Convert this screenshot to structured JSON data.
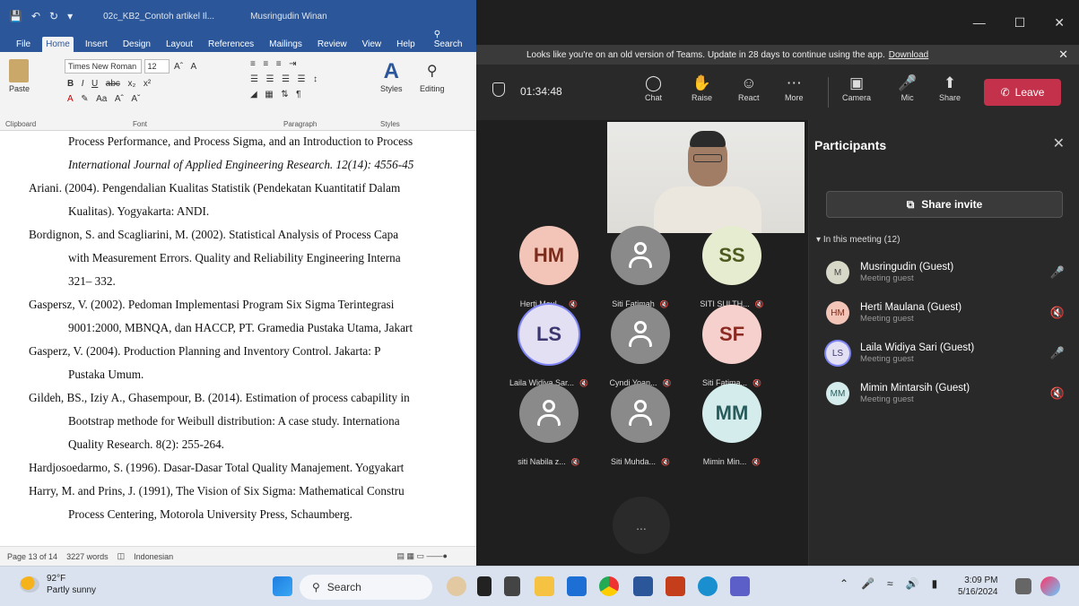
{
  "word": {
    "title_doc": "02c_KB2_Contoh artikel Il...",
    "title_user": "Musringudin Winan",
    "tabs": [
      "File",
      "Home",
      "Insert",
      "Design",
      "Layout",
      "References",
      "Mailings",
      "Review",
      "View",
      "Help"
    ],
    "search_label": "Search",
    "ribbon": {
      "paste": "Paste",
      "font_name": "Times New Roman",
      "font_size": "12",
      "styles": "Styles",
      "editing": "Editing",
      "group_clipboard": "Clipboard",
      "group_font": "Font",
      "group_paragraph": "Paragraph",
      "group_styles": "Styles"
    },
    "lines": [
      {
        "t": "Process Performance, and Process Sigma, and an Introduction to Process",
        "indent": true,
        "italic": false
      },
      {
        "t": "International Journal of Applied Engineering Research.  12(14): 4556-45",
        "indent": true,
        "italic": true
      },
      {
        "t": "Ariani. (2004). Pengendalian Kualitas Statistik (Pendekatan Kuantitatif Dalam",
        "indent": false,
        "italic": false
      },
      {
        "t": "Kualitas).  Yogyakarta: ANDI.",
        "indent": true,
        "italic": false
      },
      {
        "t": "Bordignon, S. and Scagliarini, M. (2002). Statistical Analysis of Process Capa",
        "indent": false,
        "italic": false
      },
      {
        "t": "with Measurement Errors. Quality and Reliability Engineering Interna",
        "indent": true,
        "italic": false
      },
      {
        "t": "321– 332.",
        "indent": true,
        "italic": false
      },
      {
        "t": "Gaspersz, V. (2002). Pedoman Implementasi Program Six Sigma Terintegrasi",
        "indent": false,
        "italic": false
      },
      {
        "t": "9001:2000, MBNQA, dan HACCP, PT. Gramedia Pustaka Utama, Jakart",
        "indent": true,
        "italic": false
      },
      {
        "t": "Gasperz, V. (2004). Production Planning and Inventory Control. Jakarta: P",
        "indent": false,
        "italic": false
      },
      {
        "t": "Pustaka Umum.",
        "indent": true,
        "italic": false
      },
      {
        "t": "Gildeh, BS., Iziy A., Ghasempour, B.  (2014).  Estimation of process cabapility in",
        "indent": false,
        "italic": false
      },
      {
        "t": "Bootstrap methode for Weibull distribution: A case study.  Internationa",
        "indent": true,
        "italic": false
      },
      {
        "t": "Quality Research. 8(2): 255-264.",
        "indent": true,
        "italic": false
      },
      {
        "t": "Hardjosoedarmo, S. (1996). Dasar-Dasar Total Quality Manajement. Yogyakart",
        "indent": false,
        "italic": false
      },
      {
        "t": "Harry, M. and Prins, J. (1991), The Vision of Six Sigma: Mathematical Constru",
        "indent": false,
        "italic": false
      },
      {
        "t": "Process Centering, Motorola University Press, Schaumberg.",
        "indent": true,
        "italic": false
      }
    ],
    "status": {
      "page": "Page 13 of 14",
      "words": "3227 words",
      "lang": "Indonesian"
    }
  },
  "teams": {
    "banner_text": "Looks like you're on an old version of Teams. Update in 28 days to continue using the app.",
    "banner_link": "Download",
    "timer": "01:34:48",
    "controls": {
      "chat": "Chat",
      "raise": "Raise",
      "react": "React",
      "more": "More",
      "camera": "Camera",
      "mic": "Mic",
      "share": "Share",
      "leave": "Leave"
    },
    "tiles": [
      {
        "initials": "HM",
        "name": "Herti Maul...",
        "bg": "#f3c5b8",
        "fg": "#7a2d1c",
        "generic": false
      },
      {
        "initials": "",
        "name": "Siti Fatimah",
        "bg": "#8a8a8a",
        "fg": "#fff",
        "generic": true
      },
      {
        "initials": "SS",
        "name": "SITI SULTH...",
        "bg": "#e6eccf",
        "fg": "#4d5a1f",
        "generic": false
      },
      {
        "initials": "LS",
        "name": "Laila Widiya Sar...",
        "bg": "#e2e0f2",
        "fg": "#3b3670",
        "generic": false
      },
      {
        "initials": "",
        "name": "Cyndi Yoan...",
        "bg": "#8a8a8a",
        "fg": "#fff",
        "generic": true
      },
      {
        "initials": "SF",
        "name": "Siti Fatima...",
        "bg": "#f6d0cc",
        "fg": "#8b2a22",
        "generic": false
      },
      {
        "initials": "",
        "name": "siti Nabila z...",
        "bg": "#8a8a8a",
        "fg": "#fff",
        "generic": true
      },
      {
        "initials": "",
        "name": "Siti Muhda...",
        "bg": "#8a8a8a",
        "fg": "#fff",
        "generic": true
      },
      {
        "initials": "MM",
        "name": "Mimin Min...",
        "bg": "#d5ecec",
        "fg": "#285c5c",
        "generic": false
      }
    ],
    "more_tile": "...",
    "panel": {
      "title": "Participants",
      "share_invite": "Share invite",
      "in_meeting": "In this meeting (12)",
      "people": [
        {
          "initials": "M",
          "name": "Musringudin (Guest)",
          "role": "Meeting guest",
          "bg": "#d8d8c8",
          "fg": "#444",
          "muted": false
        },
        {
          "initials": "HM",
          "name": "Herti Maulana (Guest)",
          "role": "Meeting guest",
          "bg": "#f3c5b8",
          "fg": "#7a2d1c",
          "muted": true
        },
        {
          "initials": "LS",
          "name": "Laila Widiya Sari (Guest)",
          "role": "Meeting guest",
          "bg": "#e2e0f2",
          "fg": "#3b3670",
          "muted": false
        },
        {
          "initials": "MM",
          "name": "Mimin Mintarsih (Guest)",
          "role": "Meeting guest",
          "bg": "#d5ecec",
          "fg": "#285c5c",
          "muted": true
        }
      ]
    }
  },
  "taskbar": {
    "temp": "92°F",
    "weather": "Partly sunny",
    "search": "Search",
    "time": "3:09 PM",
    "date": "5/16/2024"
  }
}
